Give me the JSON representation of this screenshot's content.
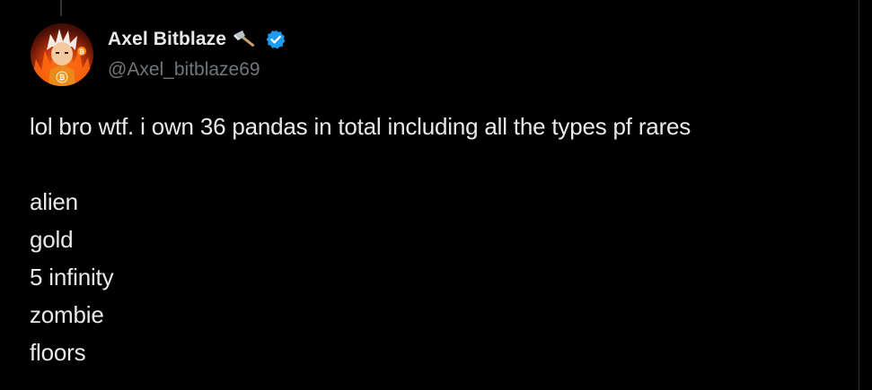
{
  "author": {
    "display_name": "Axel Bitblaze",
    "name_emoji_icon": "hammer-axe-icon",
    "verified_icon": "verified-badge-icon",
    "handle": "@Axel_bitblaze69",
    "avatar_icon": "avatar-anime-character-bitcoin-icon"
  },
  "tweet": {
    "lines": [
      "lol bro wtf. i own 36 pandas in total including all the types pf rares",
      "",
      "alien",
      "gold",
      "5 infinity",
      "zombie",
      "floors"
    ]
  },
  "colors": {
    "background": "#000000",
    "text_primary": "#e7e9ea",
    "text_secondary": "#71767b",
    "verified_blue": "#1d9bf0",
    "divider": "#2f3336"
  }
}
